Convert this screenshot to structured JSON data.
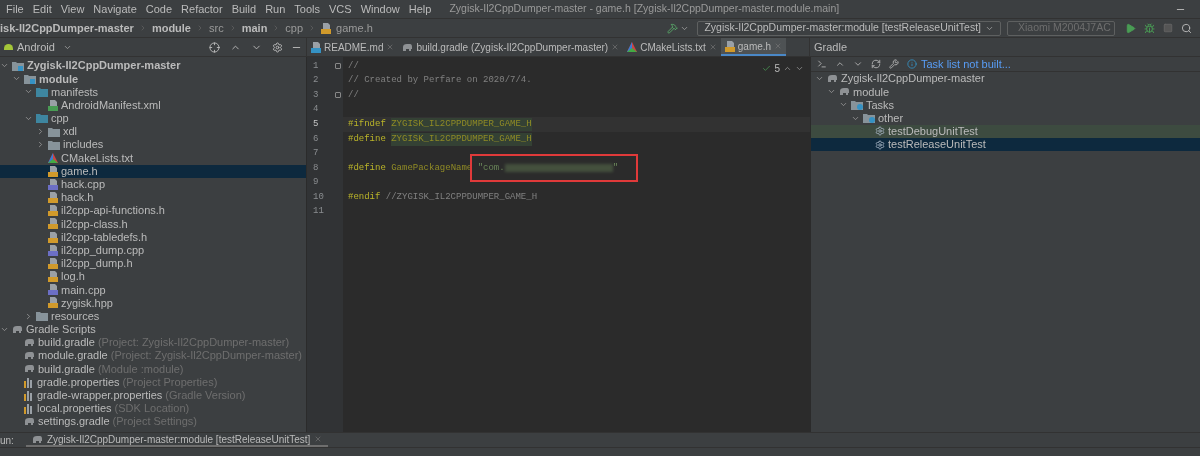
{
  "menu": [
    "File",
    "Edit",
    "View",
    "Navigate",
    "Code",
    "Refactor",
    "Build",
    "Run",
    "Tools",
    "VCS",
    "Window",
    "Help"
  ],
  "window": {
    "title": "Zygisk-Il2CppDumper-master - game.h [Zygisk-Il2CppDumper-master.module.main]"
  },
  "breadcrumb": [
    {
      "label": "isk-Il2CppDumper-master",
      "bold": true,
      "kind": "project"
    },
    {
      "label": "module",
      "bold": true,
      "kind": "plain"
    },
    {
      "label": "src",
      "bold": false,
      "kind": "plain"
    },
    {
      "label": "main",
      "bold": true,
      "kind": "plain"
    },
    {
      "label": "cpp",
      "bold": false,
      "kind": "plain"
    },
    {
      "label": "game.h",
      "bold": false,
      "kind": "header"
    }
  ],
  "run_config": {
    "label": "Zygisk-Il2CppDumper-master:module [testReleaseUnitTest]"
  },
  "device": {
    "label": "Xiaomi M2004J7AC",
    "disabled": true
  },
  "project_panel": {
    "view": "Android",
    "tree": [
      {
        "label": "Zygisk-Il2CppDumper-master",
        "kind": "module",
        "bold": true,
        "expanded": true,
        "selected": false,
        "children": [
          {
            "label": "module",
            "kind": "module",
            "bold": true,
            "expanded": true,
            "selected": false,
            "children": [
              {
                "label": "manifests",
                "kind": "folder",
                "bold": false,
                "expanded": true,
                "selected": false,
                "children": [
                  {
                    "label": "AndroidManifest.xml",
                    "kind": "manifest",
                    "bold": false,
                    "selected": false
                  }
                ]
              },
              {
                "label": "cpp",
                "kind": "folder",
                "bold": false,
                "expanded": true,
                "selected": false,
                "children": [
                  {
                    "label": "xdl",
                    "kind": "greyfolder",
                    "bold": false,
                    "expanded": false,
                    "selected": false
                  },
                  {
                    "label": "includes",
                    "kind": "greyfolder",
                    "bold": false,
                    "expanded": false,
                    "selected": false
                  },
                  {
                    "label": "CMakeLists.txt",
                    "kind": "cmake",
                    "bold": false,
                    "selected": false
                  },
                  {
                    "label": "game.h",
                    "kind": "header",
                    "bold": false,
                    "selected": true
                  },
                  {
                    "label": "hack.cpp",
                    "kind": "source",
                    "bold": false,
                    "selected": false
                  },
                  {
                    "label": "hack.h",
                    "kind": "header",
                    "bold": false,
                    "selected": false
                  },
                  {
                    "label": "il2cpp-api-functions.h",
                    "kind": "header",
                    "bold": false,
                    "selected": false
                  },
                  {
                    "label": "il2cpp-class.h",
                    "kind": "header",
                    "bold": false,
                    "selected": false
                  },
                  {
                    "label": "il2cpp-tabledefs.h",
                    "kind": "header",
                    "bold": false,
                    "selected": false
                  },
                  {
                    "label": "il2cpp_dump.cpp",
                    "kind": "source",
                    "bold": false,
                    "selected": false
                  },
                  {
                    "label": "il2cpp_dump.h",
                    "kind": "header",
                    "bold": false,
                    "selected": false
                  },
                  {
                    "label": "log.h",
                    "kind": "header",
                    "bold": false,
                    "selected": false
                  },
                  {
                    "label": "main.cpp",
                    "kind": "source",
                    "bold": false,
                    "selected": false
                  },
                  {
                    "label": "zygisk.hpp",
                    "kind": "header",
                    "bold": false,
                    "selected": false
                  }
                ]
              },
              {
                "label": "resources",
                "kind": "greyfolder",
                "bold": false,
                "expanded": false,
                "selected": false
              }
            ]
          }
        ]
      },
      {
        "label": "Gradle Scripts",
        "kind": "gradle",
        "bold": false,
        "expanded": true,
        "selected": false,
        "children": [
          {
            "label": "build.gradle",
            "note": "(Project: Zygisk-Il2CppDumper-master)",
            "kind": "gradle",
            "bold": false,
            "selected": false
          },
          {
            "label": "module.gradle",
            "note": "(Project: Zygisk-Il2CppDumper-master)",
            "kind": "gradle",
            "bold": false,
            "selected": false
          },
          {
            "label": "build.gradle",
            "note": "(Module :module)",
            "kind": "gradle",
            "bold": false,
            "selected": false
          },
          {
            "label": "gradle.properties",
            "note": "(Project Properties)",
            "kind": "properties",
            "bold": false,
            "selected": false
          },
          {
            "label": "gradle-wrapper.properties",
            "note": "(Gradle Version)",
            "kind": "properties",
            "bold": false,
            "selected": false
          },
          {
            "label": "local.properties",
            "note": "(SDK Location)",
            "kind": "properties",
            "bold": false,
            "selected": false
          },
          {
            "label": "settings.gradle",
            "note": "(Project Settings)",
            "kind": "gradle",
            "bold": false,
            "selected": false
          }
        ]
      }
    ]
  },
  "editor_tabs": [
    {
      "label": "README.md",
      "kind": "markdown",
      "selected": false
    },
    {
      "label": "build.gradle (Zygisk-Il2CppDumper-master)",
      "kind": "gradle",
      "selected": false
    },
    {
      "label": "CMakeLists.txt",
      "kind": "cmake",
      "selected": false
    },
    {
      "label": "game.h",
      "kind": "header",
      "selected": true
    }
  ],
  "editor": {
    "inspection_count": "5",
    "lines": [
      {
        "number": "1",
        "fold": true,
        "current": false,
        "tokens": [
          {
            "text": "//",
            "kind": "comment"
          }
        ]
      },
      {
        "number": "2",
        "fold": false,
        "current": false,
        "tokens": [
          {
            "text": "// Created by Perfare on 2020/7/4.",
            "kind": "comment"
          }
        ]
      },
      {
        "number": "3",
        "fold": true,
        "current": false,
        "tokens": [
          {
            "text": "//",
            "kind": "comment"
          }
        ]
      },
      {
        "number": "4",
        "fold": false,
        "current": false
      },
      {
        "number": "5",
        "fold": false,
        "current": true,
        "tokens": [
          {
            "text": "#ifndef ",
            "kind": "directive"
          },
          {
            "text": "ZYGISK_IL2CPPDUMPER_GAME_H",
            "kind": "marked"
          }
        ]
      },
      {
        "number": "6",
        "fold": false,
        "current": false,
        "tokens": [
          {
            "text": "#define ",
            "kind": "directive"
          },
          {
            "text": "ZYGISK_IL2CPPDUMPER_GAME_H",
            "kind": "marked"
          }
        ]
      },
      {
        "number": "7",
        "fold": false,
        "current": false
      },
      {
        "number": "8",
        "fold": false,
        "current": false,
        "tokens": [
          {
            "text": "#define ",
            "kind": "directive"
          },
          {
            "text": "GamePackageName ",
            "kind": "macro"
          },
          {
            "text": "\"com.",
            "kind": "string"
          },
          {
            "kind": "redacted"
          },
          {
            "text": "\"",
            "kind": "string"
          }
        ]
      },
      {
        "number": "9",
        "fold": false,
        "current": false
      },
      {
        "number": "10",
        "fold": false,
        "current": false,
        "tokens": [
          {
            "text": "#endif ",
            "kind": "directive"
          },
          {
            "text": "//ZYGISK_IL2CPPDUMPER_GAME_H",
            "kind": "comment"
          }
        ]
      },
      {
        "number": "11",
        "fold": false,
        "current": false
      }
    ]
  },
  "gradle_panel": {
    "title": "Gradle",
    "notice": "Task list not built...",
    "tree": [
      {
        "label": "Zygisk-Il2CppDumper-master",
        "kind": "gradle",
        "expanded": true,
        "selected": false,
        "hovered": false,
        "children": [
          {
            "label": "module",
            "kind": "gradle",
            "expanded": true,
            "selected": false,
            "hovered": false,
            "children": [
              {
                "label": "Tasks",
                "kind": "taskfolder",
                "expanded": true,
                "selected": false,
                "hovered": false,
                "children": [
                  {
                    "label": "other",
                    "kind": "taskfolder",
                    "expanded": true,
                    "selected": false,
                    "hovered": false,
                    "children": [
                      {
                        "label": "testDebugUnitTest",
                        "kind": "task",
                        "selected": false,
                        "hovered": true
                      },
                      {
                        "label": "testReleaseUnitTest",
                        "kind": "task",
                        "selected": true,
                        "hovered": false
                      }
                    ]
                  }
                ]
              }
            ]
          }
        ]
      }
    ]
  },
  "run_bar": {
    "label": "un:",
    "tab": "Zygisk-Il2CppDumper-master:module [testReleaseUnitTest]"
  }
}
